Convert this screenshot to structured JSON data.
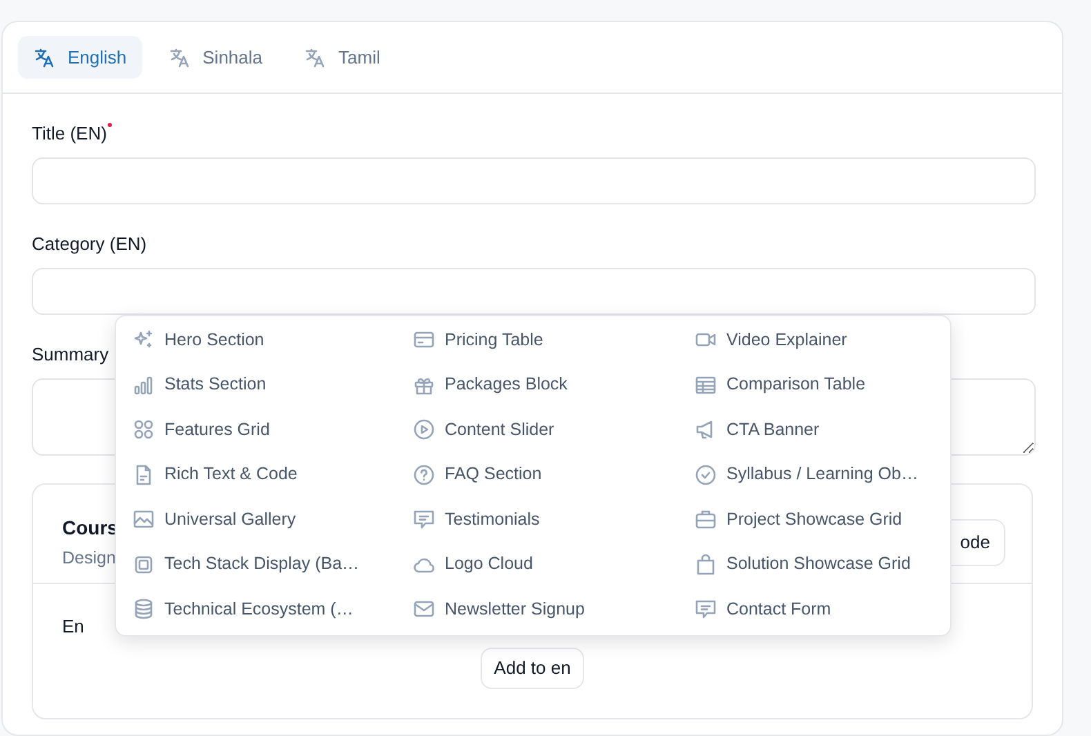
{
  "tabs": [
    {
      "label": "English",
      "selected": true
    },
    {
      "label": "Sinhala",
      "selected": false
    },
    {
      "label": "Tamil",
      "selected": false
    }
  ],
  "fields": [
    {
      "label": "Title (EN)",
      "required": true,
      "kind": "input"
    },
    {
      "label": "Category (EN)",
      "required": false,
      "kind": "input"
    },
    {
      "label": "Summary",
      "required": false,
      "kind": "textarea"
    }
  ],
  "course_section": {
    "title": "Cours",
    "subtitle": "Design",
    "mode_button": "ode",
    "row_label": "En",
    "add_button": "Add to en"
  },
  "block_menu": {
    "items": [
      {
        "label": "Hero Section"
      },
      {
        "label": "Pricing Table"
      },
      {
        "label": "Video Explainer"
      },
      {
        "label": "Stats Section"
      },
      {
        "label": "Packages Block"
      },
      {
        "label": "Comparison Table"
      },
      {
        "label": "Features Grid"
      },
      {
        "label": "Content Slider"
      },
      {
        "label": "CTA Banner"
      },
      {
        "label": "Rich Text & Code"
      },
      {
        "label": "FAQ Section"
      },
      {
        "label": "Syllabus / Learning Ob…"
      },
      {
        "label": "Universal Gallery"
      },
      {
        "label": "Testimonials"
      },
      {
        "label": "Project Showcase Grid"
      },
      {
        "label": "Tech Stack Display (Ba…"
      },
      {
        "label": "Logo Cloud"
      },
      {
        "label": "Solution Showcase Grid"
      },
      {
        "label": "Technical Ecosystem (…"
      },
      {
        "label": "Newsletter Signup"
      },
      {
        "label": "Contact Form"
      }
    ]
  }
}
